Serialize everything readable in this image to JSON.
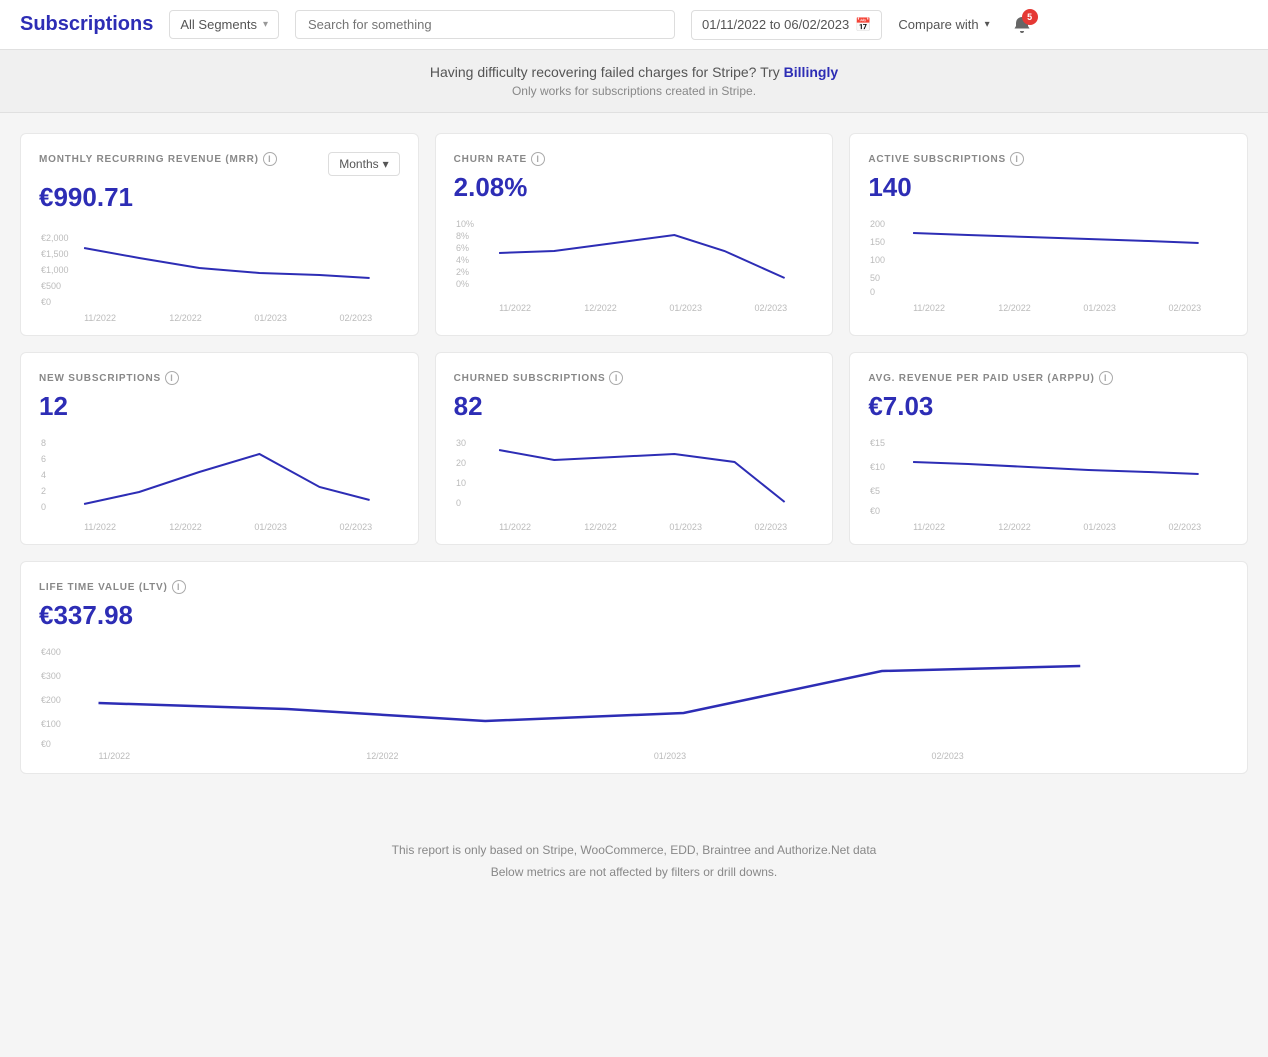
{
  "header": {
    "title": "Subscriptions",
    "segments_label": "All Segments",
    "search_placeholder": "Search for something",
    "date_range": "01/11/2022  to  06/02/2023",
    "compare_label": "Compare with",
    "notification_count": "5"
  },
  "banner": {
    "text": "Having difficulty recovering failed charges for Stripe? Try ",
    "link_text": "Billingly",
    "sub_text": "Only works for subscriptions created in Stripe."
  },
  "cards": {
    "mrr": {
      "title": "MONTHLY RECURRING REVENUE (MRR)",
      "value": "€990.71",
      "months_label": "Months"
    },
    "churn": {
      "title": "CHURN RATE",
      "value": "2.08%"
    },
    "active_subs": {
      "title": "ACTIVE SUBSCRIPTIONS",
      "value": "140"
    },
    "new_subs": {
      "title": "NEW SUBSCRIPTIONS",
      "value": "12"
    },
    "churned_subs": {
      "title": "CHURNED SUBSCRIPTIONS",
      "value": "82"
    },
    "arppu": {
      "title": "AVG. REVENUE PER PAID USER (ARPPU)",
      "value": "€7.03"
    },
    "ltv": {
      "title": "LIFE TIME VALUE (LTV)",
      "value": "€337.98"
    }
  },
  "footer": {
    "line1": "This report is only based on Stripe, WooCommerce, EDD, Braintree and Authorize.Net data",
    "line2": "Below metrics are not affected by filters or drill downs."
  }
}
